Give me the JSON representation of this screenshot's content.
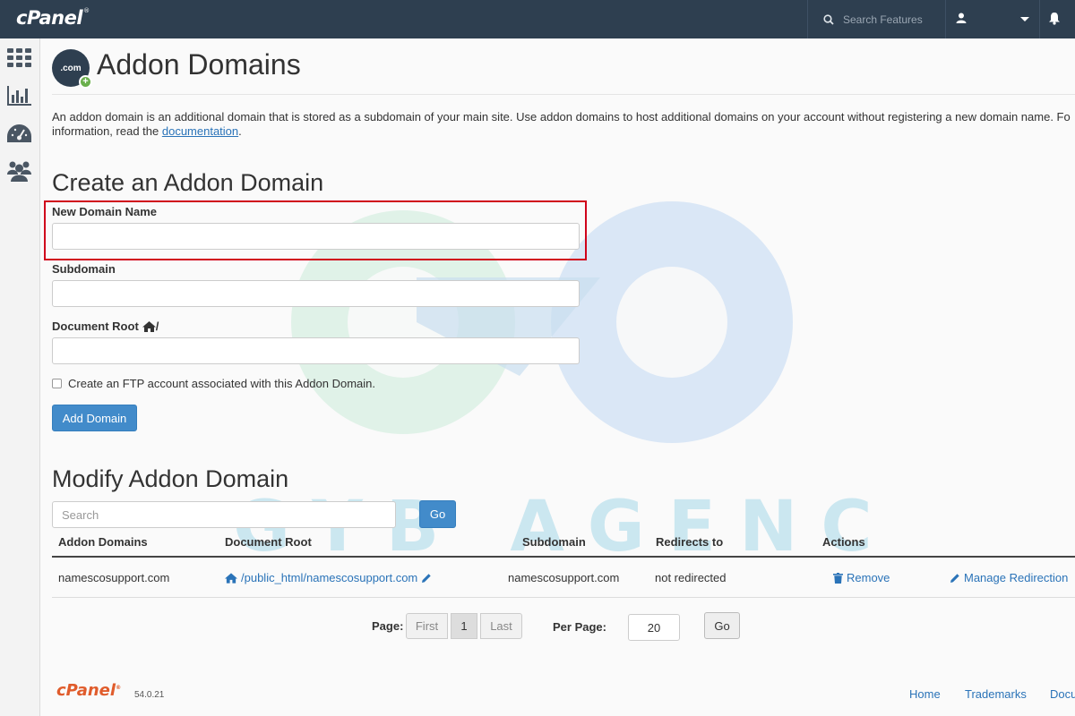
{
  "topbar": {
    "logo": "cPanel",
    "logo_mark": "®",
    "search_placeholder": "Search Features",
    "user_icon": "user-icon",
    "bell_icon": "bell-icon"
  },
  "sidebar": {
    "items": [
      {
        "icon": "grid-icon"
      },
      {
        "icon": "stats-icon"
      },
      {
        "icon": "dashboard-icon"
      },
      {
        "icon": "users-icon"
      }
    ]
  },
  "page": {
    "icon_text": ".com",
    "title": "Addon Domains",
    "description_1": "An addon domain is an additional domain that is stored as a subdomain of your main site. Use addon domains to host additional domains on your account without registering a new domain name. Fo",
    "description_2": "information, read the ",
    "description_link": "documentation",
    "description_end": "."
  },
  "create": {
    "heading": "Create an Addon Domain",
    "new_domain_label": "New Domain Name",
    "new_domain_value": "",
    "subdomain_label": "Subdomain",
    "subdomain_value": "",
    "docroot_label": "Document Root",
    "docroot_suffix": "/",
    "docroot_value": "",
    "ftp_label": "Create an FTP account associated with this Addon Domain.",
    "ftp_checked": false,
    "add_button": "Add Domain"
  },
  "modify": {
    "heading": "Modify Addon Domain",
    "search_placeholder": "Search",
    "go_button": "Go",
    "columns": [
      "Addon Domains",
      "Document Root",
      "Subdomain",
      "Redirects to",
      "Actions"
    ],
    "rows": [
      {
        "domain": "namescosupport.com",
        "docroot": "/public_html/namescosupport.com",
        "subdomain": "namescosupport.com",
        "redirects": "not redirected",
        "remove": "Remove",
        "manage": "Manage Redirection"
      }
    ]
  },
  "pagination": {
    "page_label": "Page:",
    "first": "First",
    "current": "1",
    "last": "Last",
    "per_page_label": "Per Page:",
    "per_page_value": "20",
    "go": "Go"
  },
  "footer": {
    "logo": "cPanel",
    "version": "54.0.21",
    "links": [
      "Home",
      "Trademarks",
      "Docu"
    ]
  },
  "watermark": {
    "text": "GYB AGENCY"
  },
  "colors": {
    "topbar": "#2e3f50",
    "primary": "#428bca",
    "link": "#2a73b8",
    "highlight": "#d0021b",
    "footer_logo": "#e05c2c"
  }
}
